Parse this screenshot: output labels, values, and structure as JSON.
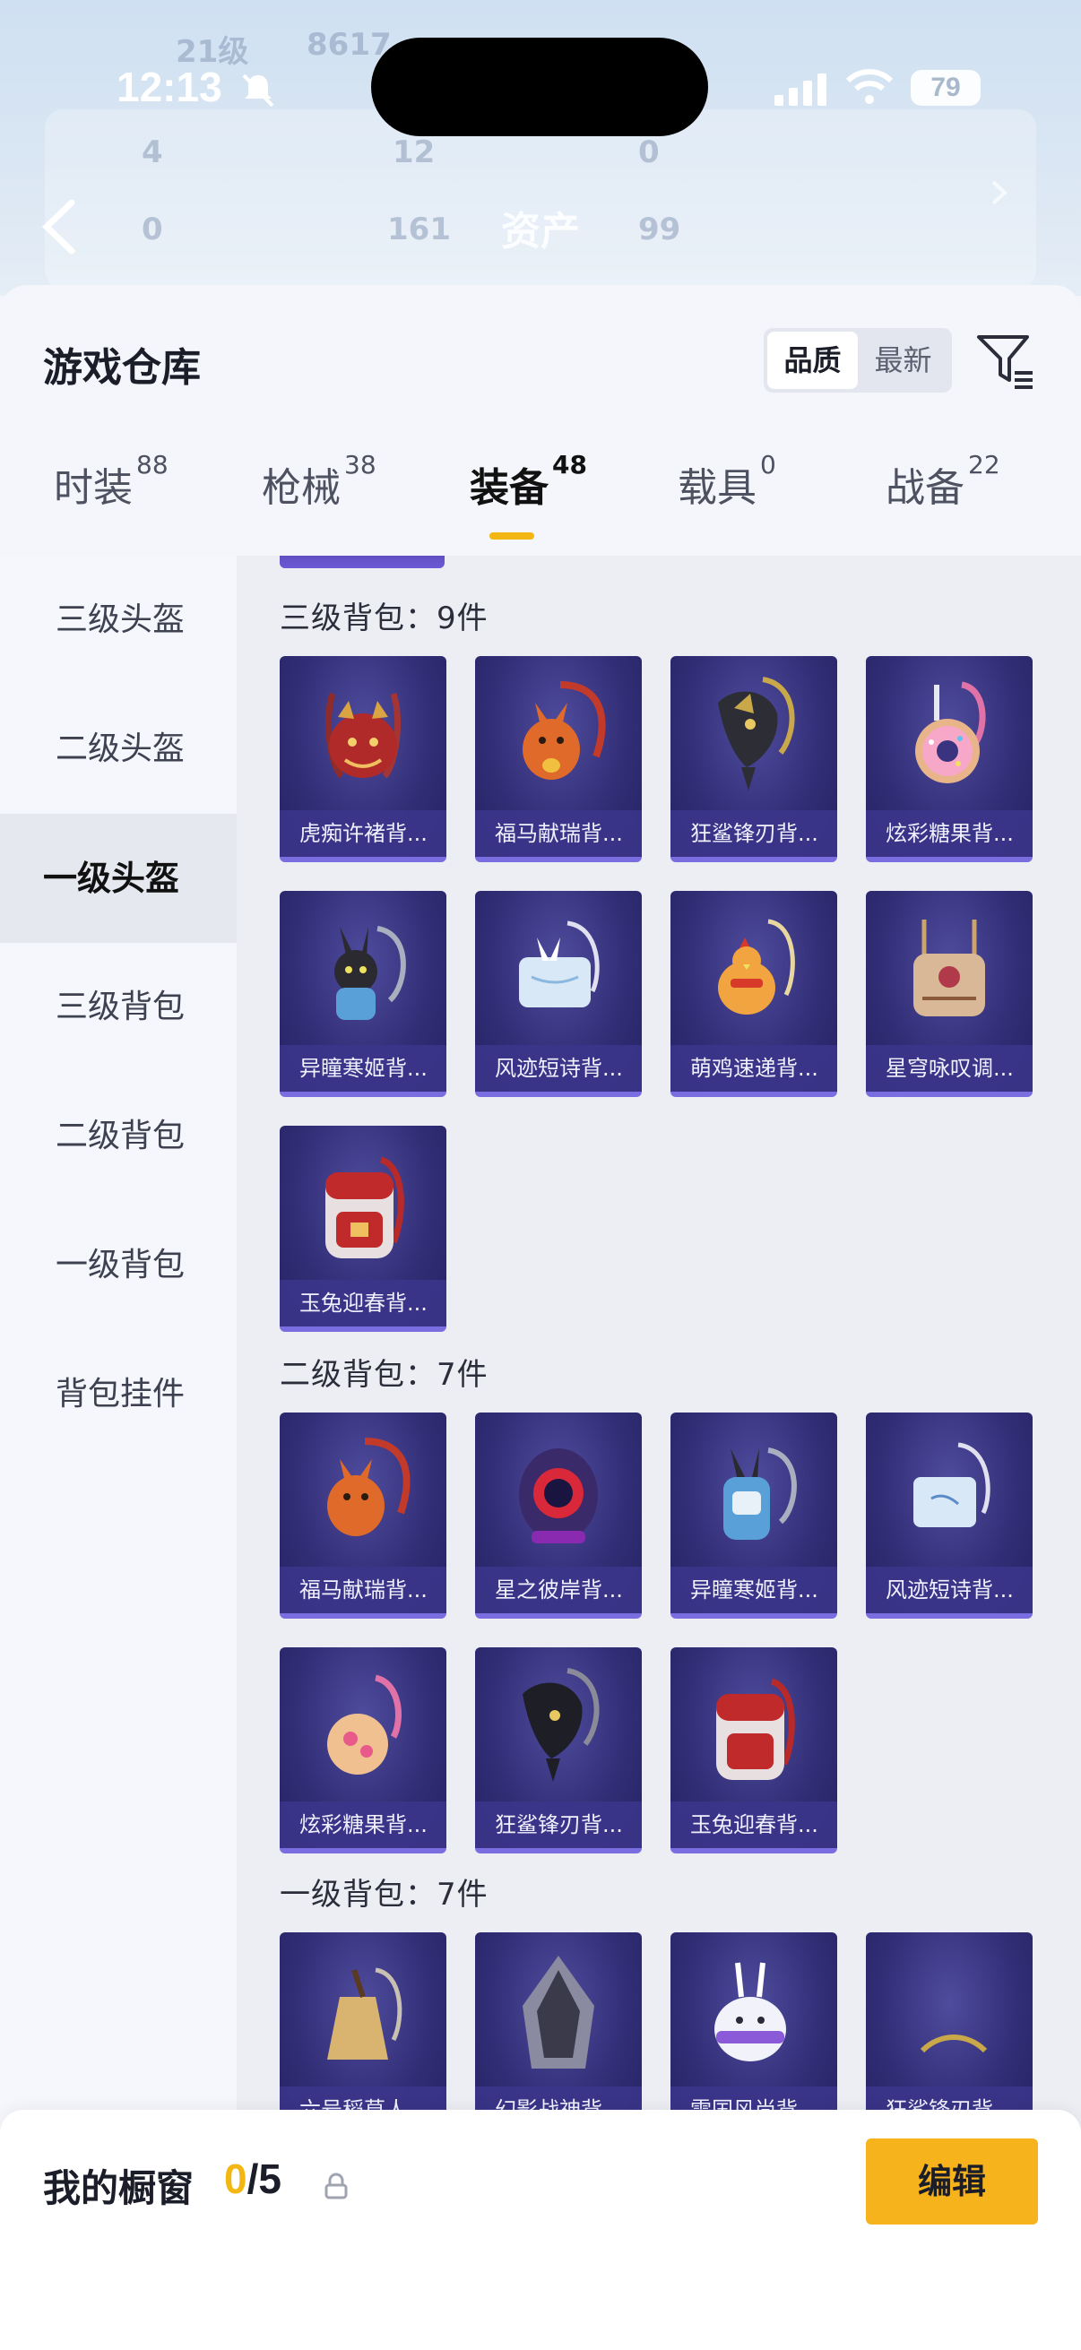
{
  "status_bar": {
    "time": "12:13",
    "battery": "79"
  },
  "header": {
    "title": "资产",
    "ghost": [
      "21级",
      "8617",
      "4",
      "12",
      "0",
      "0",
      "161",
      "99"
    ]
  },
  "sheet": {
    "title": "游戏仓库",
    "sort": {
      "quality": "品质",
      "latest": "最新"
    }
  },
  "tabs": [
    {
      "label": "时装",
      "count": "88"
    },
    {
      "label": "枪械",
      "count": "38"
    },
    {
      "label": "装备",
      "count": "48"
    },
    {
      "label": "载具",
      "count": "0"
    },
    {
      "label": "战备",
      "count": "22"
    }
  ],
  "sidebar": [
    {
      "label": "三级头盔"
    },
    {
      "label": "二级头盔"
    },
    {
      "label": "一级头盔"
    },
    {
      "label": "三级背包"
    },
    {
      "label": "二级背包"
    },
    {
      "label": "一级背包"
    },
    {
      "label": "背包挂件"
    }
  ],
  "sections": [
    {
      "title": "三级背包：9件",
      "items": [
        "虎痴许褚背...",
        "福马献瑞背...",
        "狂鲨锋刃背...",
        "炫彩糖果背...",
        "异瞳寒姬背...",
        "风迹短诗背...",
        "萌鸡速递背...",
        "星穹咏叹调...",
        "玉兔迎春背..."
      ]
    },
    {
      "title": "二级背包：7件",
      "items": [
        "福马献瑞背...",
        "星之彼岸背...",
        "异瞳寒姬背...",
        "风迹短诗背...",
        "炫彩糖果背...",
        "狂鲨锋刃背...",
        "玉兔迎春背..."
      ]
    },
    {
      "title": "一级背包：7件",
      "items": [
        "六号稻草人...",
        "幻影战神背...",
        "雪国风尚背...",
        "狂鲨锋刃背..."
      ]
    }
  ],
  "bottom": {
    "showcase_label": "我的橱窗",
    "current": "0",
    "total": "/5",
    "edit": "编辑"
  },
  "colors": {
    "accent": "#f6b31c",
    "card": "#332f78"
  }
}
